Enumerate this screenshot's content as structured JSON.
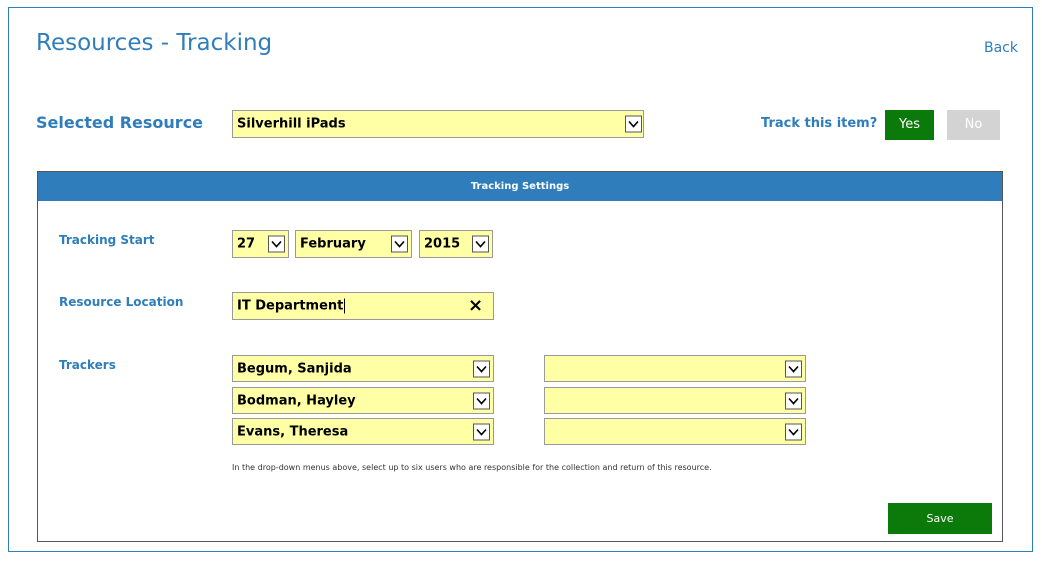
{
  "header": {
    "title": "Resources - Tracking",
    "back_label": "Back"
  },
  "resource": {
    "label": "Selected Resource",
    "value": "Silverhill iPads"
  },
  "track": {
    "question": "Track this item?",
    "yes_label": "Yes",
    "no_label": "No"
  },
  "panel": {
    "title": "Tracking Settings"
  },
  "tracking_start": {
    "label": "Tracking Start",
    "day": "27",
    "month": "February",
    "year": "2015"
  },
  "location": {
    "label": "Resource Location",
    "value": "IT Department",
    "clear_icon": "×"
  },
  "trackers": {
    "label": "Trackers",
    "left": [
      "Begum, Sanjida",
      "Bodman, Hayley",
      "Evans, Theresa"
    ],
    "right": [
      "",
      "",
      ""
    ],
    "help": "In the drop-down menus above, select up to six users who are responsible for the collection and return of this resource."
  },
  "save_label": "Save",
  "colors": {
    "accent": "#2f7dbb",
    "green": "#0b7a0b",
    "field": "#ffffa6",
    "disabled": "#d3d3d3"
  },
  "icons": [
    "chevron-down-icon",
    "close-icon"
  ]
}
